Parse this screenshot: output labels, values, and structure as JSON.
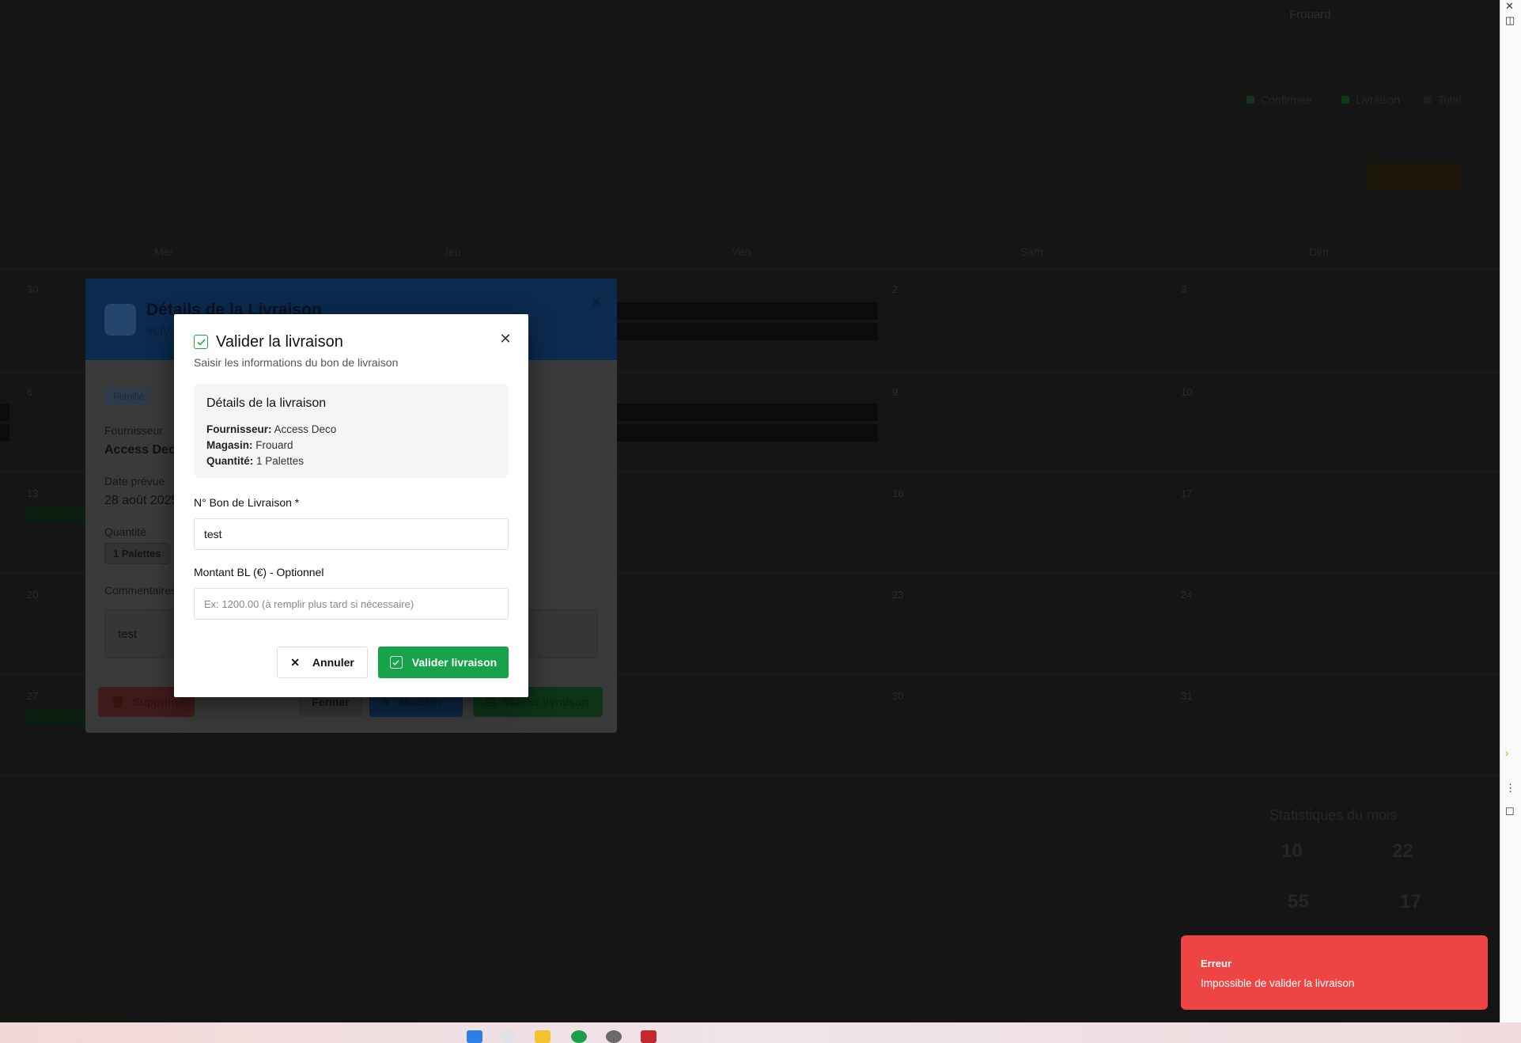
{
  "background": {
    "user_store": "Frouard",
    "legend": [
      {
        "label": "Confirmée",
        "color": "#16331e"
      },
      {
        "label": "Livraison",
        "color": "#0e3a18"
      },
      {
        "label": "Total",
        "color": "#1e1e1e"
      }
    ],
    "day_headers": [
      "Mer",
      "Jeu",
      "Ven",
      "Sam",
      "Dim"
    ],
    "day_numbers": [
      "30",
      "2",
      "3",
      "6",
      "9",
      "10",
      "13",
      "16",
      "17",
      "20",
      "23",
      "24",
      "27",
      "30",
      "31"
    ],
    "stats": {
      "title": "Statistiques du mois",
      "values": [
        "10",
        "22",
        "55",
        "17"
      ]
    }
  },
  "details_dialog": {
    "title": "Détails de la Livraison",
    "reference": "#LIV",
    "status": "Planifié",
    "supplier_label": "Fournisseur",
    "supplier_value": "Access Deco",
    "date_label": "Date prévue",
    "date_value": "28 août 2025",
    "quantity_label": "Quantité",
    "quantity_value": "1 Palettes",
    "comment_label": "Commentaires",
    "comment_value": "test",
    "buttons": {
      "delete": "Supprimer",
      "close": "Fermer",
      "edit": "Modifier",
      "validate": "Valider livraison"
    }
  },
  "modal": {
    "title": "Valider la livraison",
    "subtitle": "Saisir les informations du bon de livraison",
    "summary": {
      "title": "Détails de la livraison",
      "supplier_label": "Fournisseur:",
      "supplier_value": "Access Deco",
      "store_label": "Magasin:",
      "store_value": "Frouard",
      "quantity_label": "Quantité:",
      "quantity_value": "1 Palettes"
    },
    "bl_number_label": "N° Bon de Livraison *",
    "bl_number_value": "test",
    "amount_label": "Montant BL (€) - Optionnel",
    "amount_placeholder": "Ex: 1200.00 (à remplir plus tard si nécessaire)",
    "cancel_label": "Annuler",
    "submit_label": "Valider livraison"
  },
  "toast": {
    "title": "Erreur",
    "message": "Impossible de valider la livraison",
    "color": "#ef4444"
  },
  "taskbar": {
    "icons": [
      "windows-start-icon",
      "chrome-icon",
      "file-explorer-icon",
      "whatsapp-icon",
      "settings-icon",
      "acrobat-icon"
    ]
  }
}
